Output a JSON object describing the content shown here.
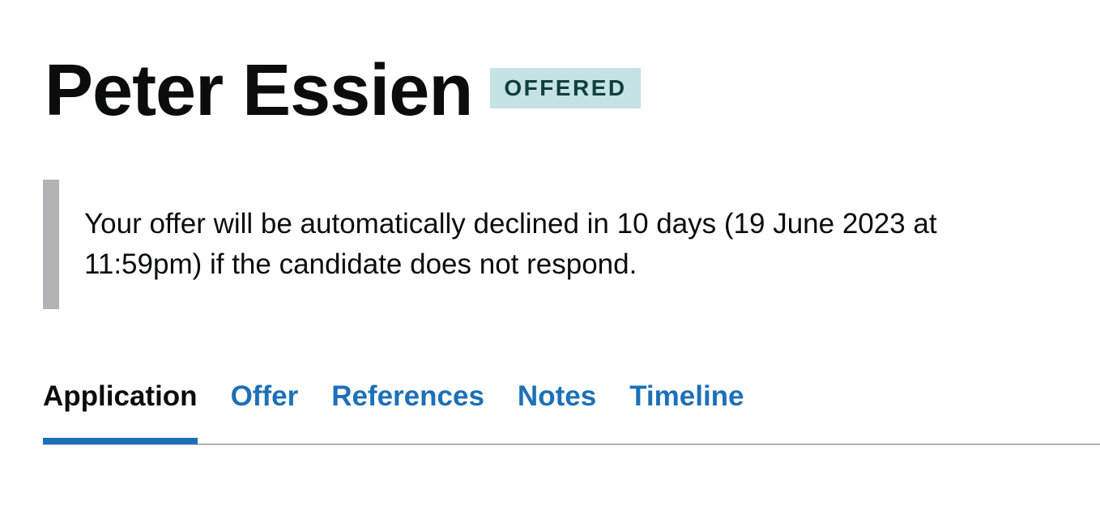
{
  "candidate": {
    "name": "Peter Essien",
    "status": "OFFERED"
  },
  "notice": {
    "text": "Your offer will be automatically declined in 10 days (19 June 2023 at 11:59pm) if the candidate does not respond."
  },
  "tabs": [
    {
      "label": "Application",
      "selected": true
    },
    {
      "label": "Offer",
      "selected": false
    },
    {
      "label": "References",
      "selected": false
    },
    {
      "label": "Notes",
      "selected": false
    },
    {
      "label": "Timeline",
      "selected": false
    }
  ],
  "colors": {
    "link": "#1d70b8",
    "text": "#0b0c0c",
    "tag_background": "#c5e3e3",
    "tag_text": "#10403c",
    "inset_border": "#b1b4b6"
  }
}
